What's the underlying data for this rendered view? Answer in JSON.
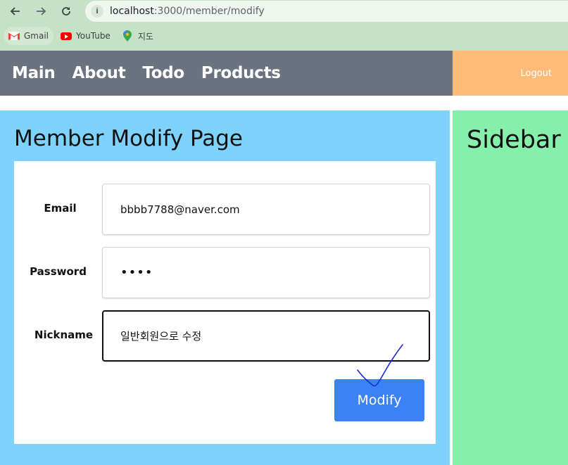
{
  "browser": {
    "url_host": "localhost",
    "url_rest": ":3000/member/modify",
    "bookmarks": [
      {
        "label": "Gmail",
        "icon": "gmail-icon"
      },
      {
        "label": "YouTube",
        "icon": "youtube-icon"
      },
      {
        "label": "지도",
        "icon": "maps-icon"
      }
    ]
  },
  "header": {
    "nav": [
      "Main",
      "About",
      "Todo",
      "Products"
    ],
    "logout_label": "Logout",
    "nav_bg": "#6b7280",
    "right_bg": "#fdbb77"
  },
  "main": {
    "title": "Member Modify Page",
    "bg": "#7dd3fc",
    "form": {
      "email_label": "Email",
      "email_value": "bbbb7788@naver.com",
      "password_label": "Password",
      "password_value": "••••",
      "nickname_label": "Nickname",
      "nickname_value": "일반회원으로 수정",
      "submit_label": "Modify"
    }
  },
  "sidebar": {
    "title": "Sidebar",
    "bg": "#86efac"
  }
}
